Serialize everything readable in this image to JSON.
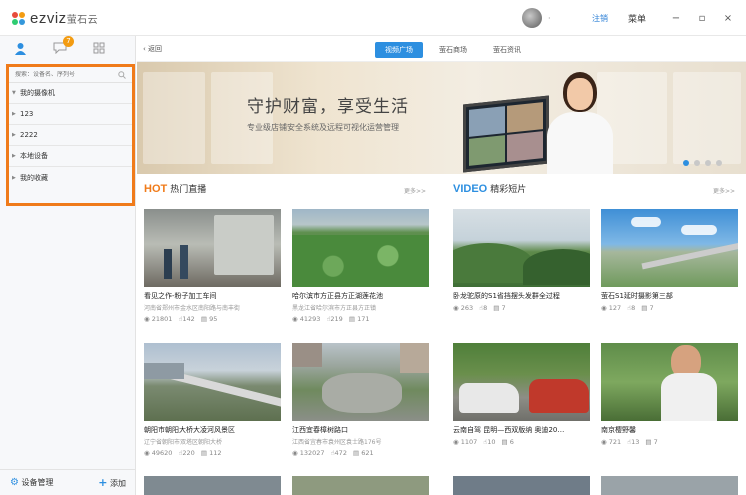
{
  "app": {
    "logo_en": "ezviz",
    "logo_cn": "萤石云",
    "brand_color": "#2d8fe0",
    "highlight_color": "#f07b1a"
  },
  "header": {
    "username": "·",
    "logout": "注销",
    "menu": "菜单",
    "minimize": "−",
    "maximize": "▫",
    "close": "×"
  },
  "sidebar": {
    "notification_count": "7",
    "search_placeholder": "搜索：设备名、序列号",
    "items": [
      {
        "label": "我的摄像机",
        "expanded": true
      },
      {
        "label": "123",
        "expanded": false
      },
      {
        "label": "2222",
        "expanded": false
      },
      {
        "label": "本地设备",
        "expanded": false
      },
      {
        "label": "我的收藏",
        "expanded": false
      }
    ],
    "footer": {
      "manage": "设备管理",
      "add": "添加"
    }
  },
  "nav": {
    "back": "返回",
    "tabs": [
      {
        "label": "视频广场",
        "active": true
      },
      {
        "label": "萤石商场",
        "active": false
      },
      {
        "label": "萤石资讯",
        "active": false
      }
    ]
  },
  "banner": {
    "title": "守护财富，享受生活",
    "subtitle": "专业级店铺安全系统及远程可视化运营管理",
    "active_slide": 1,
    "slide_count": 4
  },
  "hot": {
    "tag": "HOT",
    "name": "热门直播",
    "more": "更多>>",
    "cards": [
      {
        "title": "看见之作-粉子加工车间",
        "sub": "河南省郑州市金水区南阳路与南丰街",
        "views": "21801",
        "likes": "142",
        "comments": "95"
      },
      {
        "title": "哈尔滨市方正县方正湖莲花池",
        "sub": "黑龙江省哈尔滨市方正县方正镇",
        "views": "41293",
        "likes": "219",
        "comments": "171"
      },
      {
        "title": "朝阳市朝阳大桥大凌河风景区",
        "sub": "辽宁省朝阳市双塔区朝阳大桥",
        "views": "49620",
        "likes": "220",
        "comments": "112"
      },
      {
        "title": "江西宜春樟树路口",
        "sub": "江西省宜春市袁州区袁士路176号",
        "views": "132027",
        "likes": "472",
        "comments": "621"
      }
    ]
  },
  "video": {
    "tag": "VIDEO",
    "name": "精彩短片",
    "more": "更多>>",
    "cards": [
      {
        "title": "卧龙驼原的S1省挡摆头发群全过程",
        "views": "263",
        "likes": "8",
        "comments": "7"
      },
      {
        "title": "萤石S1延时摄影第三部",
        "views": "127",
        "likes": "8",
        "comments": "7"
      },
      {
        "title": "云南自驾 昆明—西双版纳 奥迪20…",
        "views": "1107",
        "likes": "10",
        "comments": "6"
      },
      {
        "title": "南京樱野馨",
        "views": "721",
        "likes": "13",
        "comments": "7"
      }
    ]
  }
}
